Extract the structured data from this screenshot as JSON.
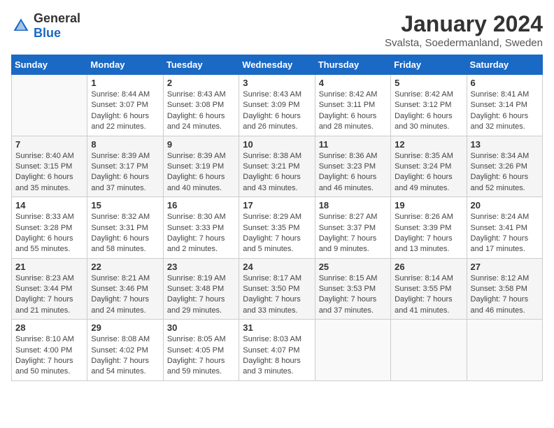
{
  "header": {
    "logo_general": "General",
    "logo_blue": "Blue",
    "month": "January 2024",
    "location": "Svalsta, Soedermanland, Sweden"
  },
  "days_of_week": [
    "Sunday",
    "Monday",
    "Tuesday",
    "Wednesday",
    "Thursday",
    "Friday",
    "Saturday"
  ],
  "weeks": [
    [
      {
        "day": "",
        "sunrise": "",
        "sunset": "",
        "daylight": ""
      },
      {
        "day": "1",
        "sunrise": "Sunrise: 8:44 AM",
        "sunset": "Sunset: 3:07 PM",
        "daylight": "Daylight: 6 hours and 22 minutes."
      },
      {
        "day": "2",
        "sunrise": "Sunrise: 8:43 AM",
        "sunset": "Sunset: 3:08 PM",
        "daylight": "Daylight: 6 hours and 24 minutes."
      },
      {
        "day": "3",
        "sunrise": "Sunrise: 8:43 AM",
        "sunset": "Sunset: 3:09 PM",
        "daylight": "Daylight: 6 hours and 26 minutes."
      },
      {
        "day": "4",
        "sunrise": "Sunrise: 8:42 AM",
        "sunset": "Sunset: 3:11 PM",
        "daylight": "Daylight: 6 hours and 28 minutes."
      },
      {
        "day": "5",
        "sunrise": "Sunrise: 8:42 AM",
        "sunset": "Sunset: 3:12 PM",
        "daylight": "Daylight: 6 hours and 30 minutes."
      },
      {
        "day": "6",
        "sunrise": "Sunrise: 8:41 AM",
        "sunset": "Sunset: 3:14 PM",
        "daylight": "Daylight: 6 hours and 32 minutes."
      }
    ],
    [
      {
        "day": "7",
        "sunrise": "Sunrise: 8:40 AM",
        "sunset": "Sunset: 3:15 PM",
        "daylight": "Daylight: 6 hours and 35 minutes."
      },
      {
        "day": "8",
        "sunrise": "Sunrise: 8:39 AM",
        "sunset": "Sunset: 3:17 PM",
        "daylight": "Daylight: 6 hours and 37 minutes."
      },
      {
        "day": "9",
        "sunrise": "Sunrise: 8:39 AM",
        "sunset": "Sunset: 3:19 PM",
        "daylight": "Daylight: 6 hours and 40 minutes."
      },
      {
        "day": "10",
        "sunrise": "Sunrise: 8:38 AM",
        "sunset": "Sunset: 3:21 PM",
        "daylight": "Daylight: 6 hours and 43 minutes."
      },
      {
        "day": "11",
        "sunrise": "Sunrise: 8:36 AM",
        "sunset": "Sunset: 3:23 PM",
        "daylight": "Daylight: 6 hours and 46 minutes."
      },
      {
        "day": "12",
        "sunrise": "Sunrise: 8:35 AM",
        "sunset": "Sunset: 3:24 PM",
        "daylight": "Daylight: 6 hours and 49 minutes."
      },
      {
        "day": "13",
        "sunrise": "Sunrise: 8:34 AM",
        "sunset": "Sunset: 3:26 PM",
        "daylight": "Daylight: 6 hours and 52 minutes."
      }
    ],
    [
      {
        "day": "14",
        "sunrise": "Sunrise: 8:33 AM",
        "sunset": "Sunset: 3:28 PM",
        "daylight": "Daylight: 6 hours and 55 minutes."
      },
      {
        "day": "15",
        "sunrise": "Sunrise: 8:32 AM",
        "sunset": "Sunset: 3:31 PM",
        "daylight": "Daylight: 6 hours and 58 minutes."
      },
      {
        "day": "16",
        "sunrise": "Sunrise: 8:30 AM",
        "sunset": "Sunset: 3:33 PM",
        "daylight": "Daylight: 7 hours and 2 minutes."
      },
      {
        "day": "17",
        "sunrise": "Sunrise: 8:29 AM",
        "sunset": "Sunset: 3:35 PM",
        "daylight": "Daylight: 7 hours and 5 minutes."
      },
      {
        "day": "18",
        "sunrise": "Sunrise: 8:27 AM",
        "sunset": "Sunset: 3:37 PM",
        "daylight": "Daylight: 7 hours and 9 minutes."
      },
      {
        "day": "19",
        "sunrise": "Sunrise: 8:26 AM",
        "sunset": "Sunset: 3:39 PM",
        "daylight": "Daylight: 7 hours and 13 minutes."
      },
      {
        "day": "20",
        "sunrise": "Sunrise: 8:24 AM",
        "sunset": "Sunset: 3:41 PM",
        "daylight": "Daylight: 7 hours and 17 minutes."
      }
    ],
    [
      {
        "day": "21",
        "sunrise": "Sunrise: 8:23 AM",
        "sunset": "Sunset: 3:44 PM",
        "daylight": "Daylight: 7 hours and 21 minutes."
      },
      {
        "day": "22",
        "sunrise": "Sunrise: 8:21 AM",
        "sunset": "Sunset: 3:46 PM",
        "daylight": "Daylight: 7 hours and 24 minutes."
      },
      {
        "day": "23",
        "sunrise": "Sunrise: 8:19 AM",
        "sunset": "Sunset: 3:48 PM",
        "daylight": "Daylight: 7 hours and 29 minutes."
      },
      {
        "day": "24",
        "sunrise": "Sunrise: 8:17 AM",
        "sunset": "Sunset: 3:50 PM",
        "daylight": "Daylight: 7 hours and 33 minutes."
      },
      {
        "day": "25",
        "sunrise": "Sunrise: 8:15 AM",
        "sunset": "Sunset: 3:53 PM",
        "daylight": "Daylight: 7 hours and 37 minutes."
      },
      {
        "day": "26",
        "sunrise": "Sunrise: 8:14 AM",
        "sunset": "Sunset: 3:55 PM",
        "daylight": "Daylight: 7 hours and 41 minutes."
      },
      {
        "day": "27",
        "sunrise": "Sunrise: 8:12 AM",
        "sunset": "Sunset: 3:58 PM",
        "daylight": "Daylight: 7 hours and 46 minutes."
      }
    ],
    [
      {
        "day": "28",
        "sunrise": "Sunrise: 8:10 AM",
        "sunset": "Sunset: 4:00 PM",
        "daylight": "Daylight: 7 hours and 50 minutes."
      },
      {
        "day": "29",
        "sunrise": "Sunrise: 8:08 AM",
        "sunset": "Sunset: 4:02 PM",
        "daylight": "Daylight: 7 hours and 54 minutes."
      },
      {
        "day": "30",
        "sunrise": "Sunrise: 8:05 AM",
        "sunset": "Sunset: 4:05 PM",
        "daylight": "Daylight: 7 hours and 59 minutes."
      },
      {
        "day": "31",
        "sunrise": "Sunrise: 8:03 AM",
        "sunset": "Sunset: 4:07 PM",
        "daylight": "Daylight: 8 hours and 3 minutes."
      },
      {
        "day": "",
        "sunrise": "",
        "sunset": "",
        "daylight": ""
      },
      {
        "day": "",
        "sunrise": "",
        "sunset": "",
        "daylight": ""
      },
      {
        "day": "",
        "sunrise": "",
        "sunset": "",
        "daylight": ""
      }
    ]
  ]
}
